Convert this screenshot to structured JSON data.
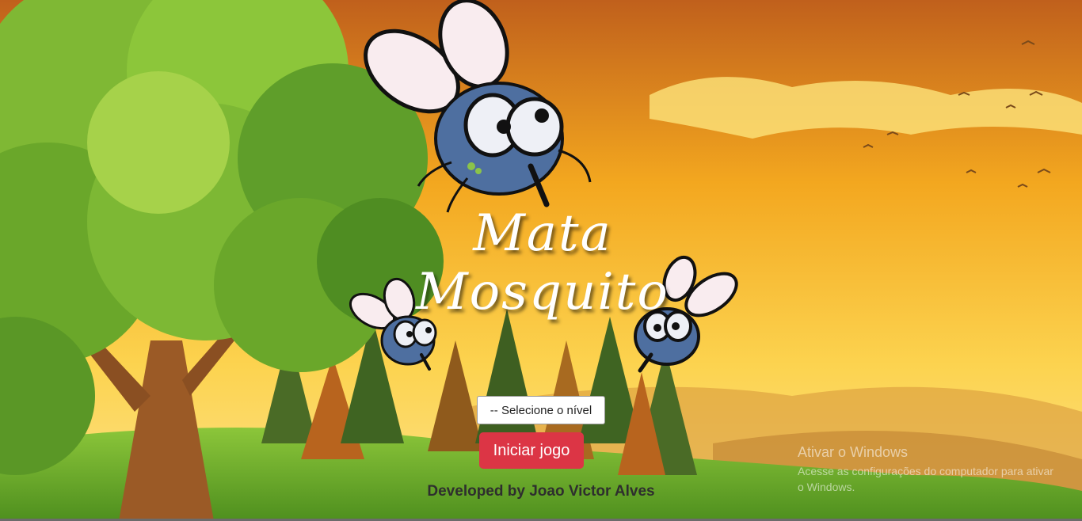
{
  "game": {
    "title_line1": "Mata",
    "title_line2": "Mosquito",
    "level_select_placeholder": "-- Selecione o nível",
    "start_button": "Iniciar jogo",
    "credit": "Developed by Joao Victor Alves"
  },
  "watermark": {
    "title": "Ativar o Windows",
    "subtitle": "Acesse as configurações do computador para ativar o Windows."
  },
  "colors": {
    "start_button": "#dc3545",
    "sky_top": "#c8651c",
    "sky_bottom": "#fbd24a",
    "grass": "#6aae2a"
  }
}
